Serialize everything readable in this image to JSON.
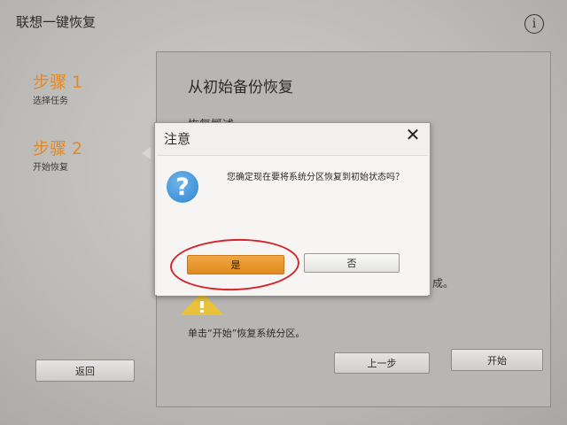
{
  "app": {
    "title": "联想一键恢复"
  },
  "icons": {
    "info": "info-icon",
    "question": "question-icon",
    "warning": "warning-icon",
    "close": "close-icon"
  },
  "sidebar": {
    "steps": [
      {
        "title": "步骤 1",
        "subtitle": "选择任务"
      },
      {
        "title": "步骤 2",
        "subtitle": "开始恢复"
      }
    ]
  },
  "main": {
    "heading": "从初始备份恢复",
    "subheading": "恢复概述",
    "partial_text": "成。",
    "hint": "单击“开始”恢复系统分区。",
    "back_label": "返回",
    "prev_label": "上一步",
    "start_label": "开始"
  },
  "dialog": {
    "title": "注意",
    "close_glyph": "✕",
    "message": "您确定现在要将系统分区恢复到初始状态吗？",
    "yes_label": "是",
    "no_label": "否"
  },
  "colors": {
    "accent": "#e08a2c",
    "primary_button": "#e99a2e",
    "annotation": "#d5242a",
    "question_icon": "#3a8fd8"
  }
}
